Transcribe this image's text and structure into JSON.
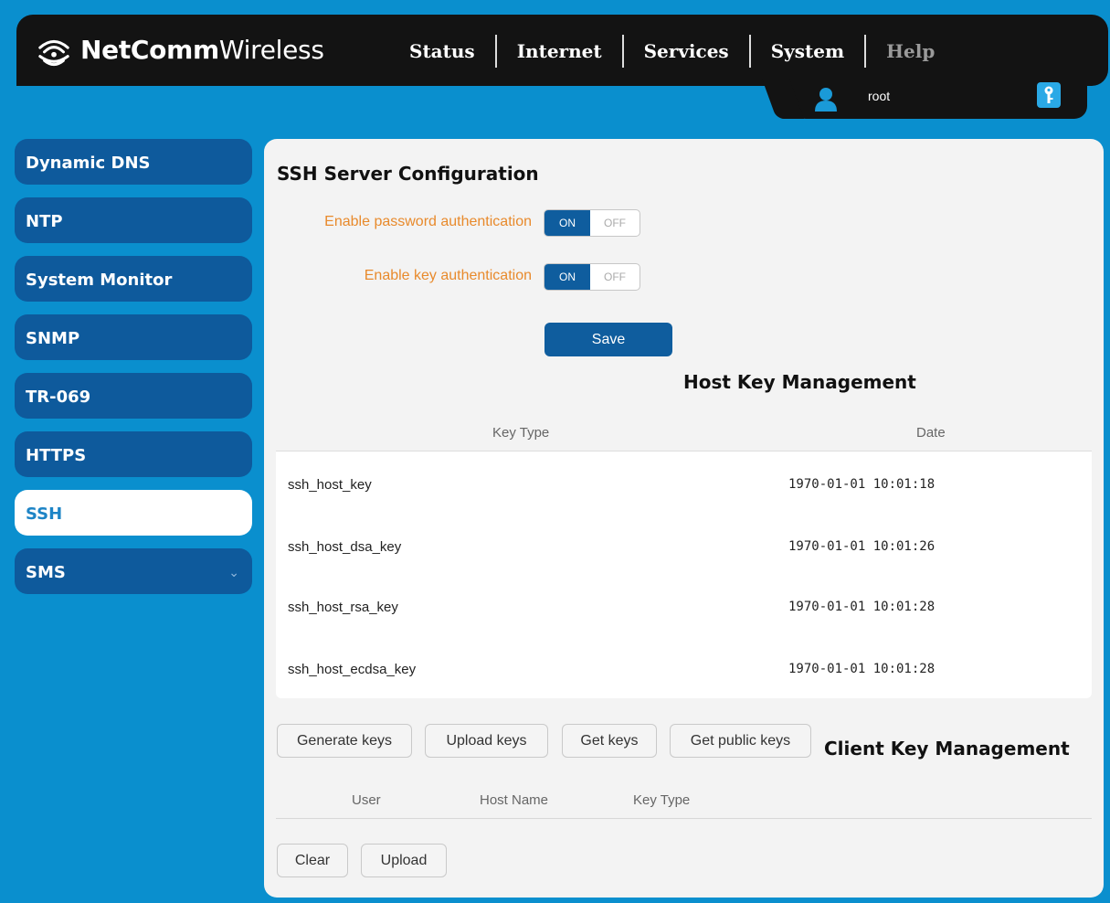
{
  "brand": {
    "name_bold": "NetComm",
    "name_light": "Wireless"
  },
  "nav": [
    {
      "label": "Status"
    },
    {
      "label": "Internet"
    },
    {
      "label": "Services"
    },
    {
      "label": "System"
    },
    {
      "label": "Help"
    }
  ],
  "user": {
    "name": "root"
  },
  "sidebar": {
    "items": [
      {
        "label": "Dynamic DNS"
      },
      {
        "label": "NTP"
      },
      {
        "label": "System Monitor"
      },
      {
        "label": "SNMP"
      },
      {
        "label": "TR-069"
      },
      {
        "label": "HTTPS"
      },
      {
        "label": "SSH",
        "active": true
      },
      {
        "label": "SMS",
        "has_chevron": true
      }
    ]
  },
  "ssh_config": {
    "title": "SSH Server Configuration",
    "password_auth": {
      "label": "Enable password authentication",
      "on_label": "ON",
      "off_label": "OFF",
      "value": "ON"
    },
    "key_auth": {
      "label": "Enable key authentication",
      "on_label": "ON",
      "off_label": "OFF",
      "value": "ON"
    },
    "save_label": "Save"
  },
  "host_keys": {
    "title": "Host Key Management",
    "columns": [
      "Key Type",
      "Date"
    ],
    "rows": [
      {
        "key_type": "ssh_host_key",
        "date": "1970-01-01 10:01:18"
      },
      {
        "key_type": "ssh_host_dsa_key",
        "date": "1970-01-01 10:01:26"
      },
      {
        "key_type": "ssh_host_rsa_key",
        "date": "1970-01-01 10:01:28"
      },
      {
        "key_type": "ssh_host_ecdsa_key",
        "date": "1970-01-01 10:01:28"
      }
    ],
    "buttons": {
      "generate": "Generate keys",
      "upload": "Upload keys",
      "get": "Get keys",
      "get_public": "Get public keys"
    }
  },
  "client_keys": {
    "title": "Client Key Management",
    "columns": [
      "User",
      "Host Name",
      "Key Type"
    ],
    "buttons": {
      "clear": "Clear",
      "upload": "Upload"
    }
  },
  "colors": {
    "background": "#0a8fce",
    "header": "#131313",
    "sidebar_item": "#0e5a9c",
    "accent": "#0f5d9e",
    "label_orange": "#e88a2c"
  }
}
